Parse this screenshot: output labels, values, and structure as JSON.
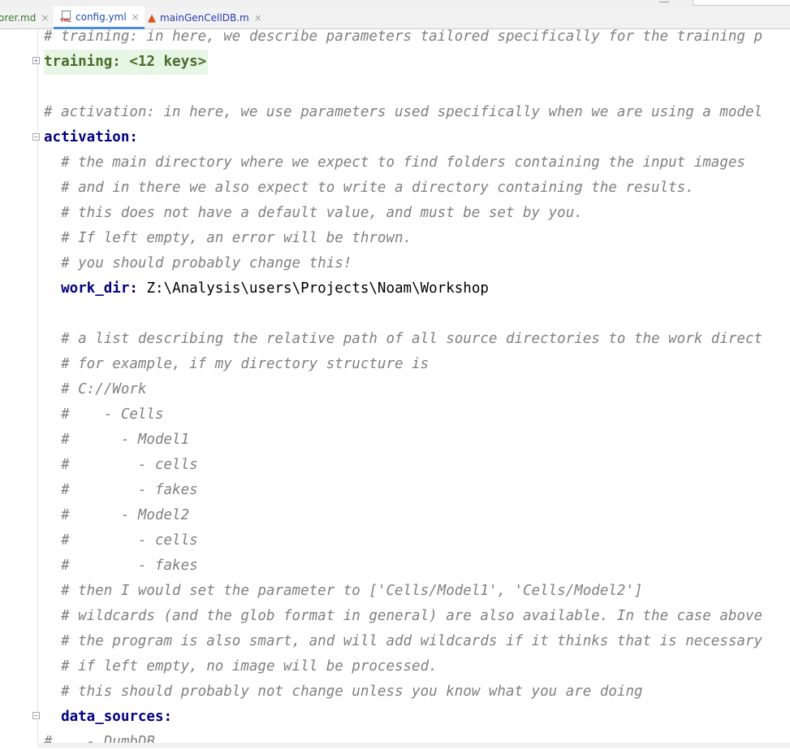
{
  "tabs": [
    {
      "label": "orer.md",
      "icon": "markdown-file-icon"
    },
    {
      "label": "config.yml",
      "icon": "yaml-file-icon",
      "active": true
    },
    {
      "label": "mainGenCellDB.m",
      "icon": "matlab-file-icon"
    }
  ],
  "tab_close_glyph": "×",
  "yml_icon_text": "YML",
  "editor": {
    "lines": [
      {
        "indent": "",
        "comment": "# training: in here, we describe parameters tailored specifically for the training p"
      },
      {
        "indent": "",
        "folded": "training: <12 keys>"
      },
      {
        "indent": "",
        "comment": ""
      },
      {
        "indent": "",
        "comment": "# activation: in here, we use parameters used specifically when we are using a model"
      },
      {
        "indent": "",
        "key": "activation",
        "colon": ":"
      },
      {
        "indent": "  ",
        "comment": "# the main directory where we expect to find folders containing the input images"
      },
      {
        "indent": "  ",
        "comment": "# and in there we also expect to write a directory containing the results."
      },
      {
        "indent": "  ",
        "comment": "# this does not have a default value, and must be set by you."
      },
      {
        "indent": "  ",
        "comment": "# If left empty, an error will be thrown."
      },
      {
        "indent": "  ",
        "comment": "# you should probably change this!"
      },
      {
        "indent": "  ",
        "key": "work_dir",
        "colon": ":",
        "value": " Z:\\Analysis\\users\\Projects\\Noam\\Workshop"
      },
      {
        "indent": "",
        "comment": ""
      },
      {
        "indent": "  ",
        "comment": "# a list describing the relative path of all source directories to the work direct"
      },
      {
        "indent": "  ",
        "comment": "# for example, if my directory structure is"
      },
      {
        "indent": "  ",
        "comment": "# C://Work"
      },
      {
        "indent": "  ",
        "comment": "#    - Cells"
      },
      {
        "indent": "  ",
        "comment": "#      - Model1"
      },
      {
        "indent": "  ",
        "comment": "#        - cells"
      },
      {
        "indent": "  ",
        "comment": "#        - fakes"
      },
      {
        "indent": "  ",
        "comment": "#      - Model2"
      },
      {
        "indent": "  ",
        "comment": "#        - cells"
      },
      {
        "indent": "  ",
        "comment": "#        - fakes"
      },
      {
        "indent": "  ",
        "comment": "# then I would set the parameter to ['Cells/Model1', 'Cells/Model2']"
      },
      {
        "indent": "  ",
        "comment": "# wildcards (and the glob format in general) are also available. In the case above"
      },
      {
        "indent": "  ",
        "comment": "# the program is also smart, and will add wildcards if it thinks that is necessary"
      },
      {
        "indent": "  ",
        "comment": "# if left empty, no image will be processed."
      },
      {
        "indent": "  ",
        "comment": "# this should probably not change unless you know what you are doing"
      },
      {
        "indent": "  ",
        "key": "data_sources",
        "colon": ":"
      },
      {
        "indent": "",
        "comment": "#    - DumbDB"
      }
    ]
  }
}
